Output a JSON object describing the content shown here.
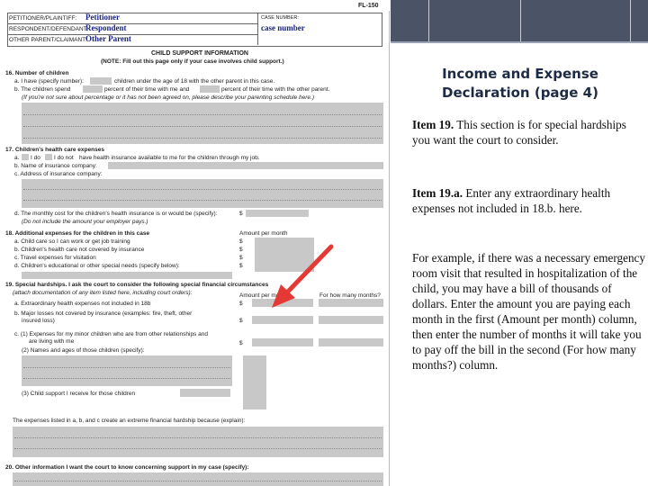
{
  "form": {
    "form_number": "FL-150",
    "header": {
      "petitioner_label": "PETITIONER/PLAINTIFF:",
      "petitioner_value": "Petitioner",
      "respondent_label": "RESPONDENT/DEFENDANT:",
      "respondent_value": "Respondent",
      "other_label": "OTHER PARENT/CLAIMANT:",
      "other_value": "Other Parent",
      "case_label": "CASE NUMBER:",
      "case_value": "case number"
    },
    "title": "CHILD SUPPORT INFORMATION",
    "note": "(NOTE: Fill out this page only if your case involves child support.)",
    "s16": {
      "heading": "16. Number of children",
      "a": "a. I have (specify number):",
      "a_tail": "children under the age of 18 with the other parent in this case.",
      "b": "b. The children spend",
      "b_mid": "percent of their time with me and",
      "b_tail": "percent of their time with the other parent.",
      "b_note": "(If you're not sure about percentage or it has not been agreed on, please describe your parenting schedule here.)"
    },
    "s17": {
      "heading": "17. Children's health care expenses",
      "a": "a.",
      "a_do": "I do",
      "a_donot": "I do not",
      "a_tail": "have health insurance available to me for the children through my job.",
      "b": "b. Name of insurance company:",
      "c": "c. Address of insurance company:",
      "d": "d. The monthly cost for the children's health insurance is or would be (specify):",
      "d_currency": "$",
      "d_note": "(Do not include the amount your employer pays.)"
    },
    "s18": {
      "heading": "18. Additional expenses for the children in this case",
      "col": "Amount per month",
      "rows": [
        "a. Child care so I can work or get job training",
        "b. Children's health care not covered by insurance",
        "c. Travel expenses for visitation",
        "d. Children's educational or other special needs (specify below):"
      ],
      "currency": "$"
    },
    "s19": {
      "heading": "19. Special hardships. I ask the court to consider the following special financial circumstances",
      "sub": "(attach documentation of any item listed here, including court orders):",
      "col1": "Amount per month",
      "col2": "For how many months?",
      "a": "a. Extraordinary health expenses not included in 18b",
      "b1": "b. Major losses not covered by insurance (examples: fire, theft, other",
      "b2": "insured loss)",
      "c1": "c. (1) Expenses for my minor children who are from other relationships and",
      "c2": "are living with me",
      "c3": "(2) Names and ages of those children (specify):",
      "c4": "(3) Child support I receive for those children",
      "currency": "$",
      "explain": "The expenses listed in a, b, and c create an extreme financial hardship because (explain):"
    },
    "s20": {
      "heading": "20. Other information I want the court to know concerning support in my case (specify):"
    }
  },
  "panel": {
    "title": "Income and Expense Declaration (page 4)",
    "p1_bold": "Item 19.",
    "p1_text": "  This section is for special hardships you want the court to consider.",
    "p2_bold": "Item 19.a.",
    "p2_text": "  Enter any extraordinary health expenses not included in 18.b. here.",
    "p3_text": "For example, if there was a necessary emergency room visit that resulted in hospitalization of the child, you may have a bill of thousands of dollars.  Enter the amount you are paying each month in the first (Amount per month) column, then enter the number of months it will take you to pay off the bill in the second (For how many months?) column."
  },
  "colors": {
    "topbar": "#4a5466",
    "field_gray": "#c8c8c8",
    "arrow": "#e53935",
    "handwriting": "#1a237e"
  },
  "icons": {
    "arrow": "red-pointer-arrow-icon"
  }
}
